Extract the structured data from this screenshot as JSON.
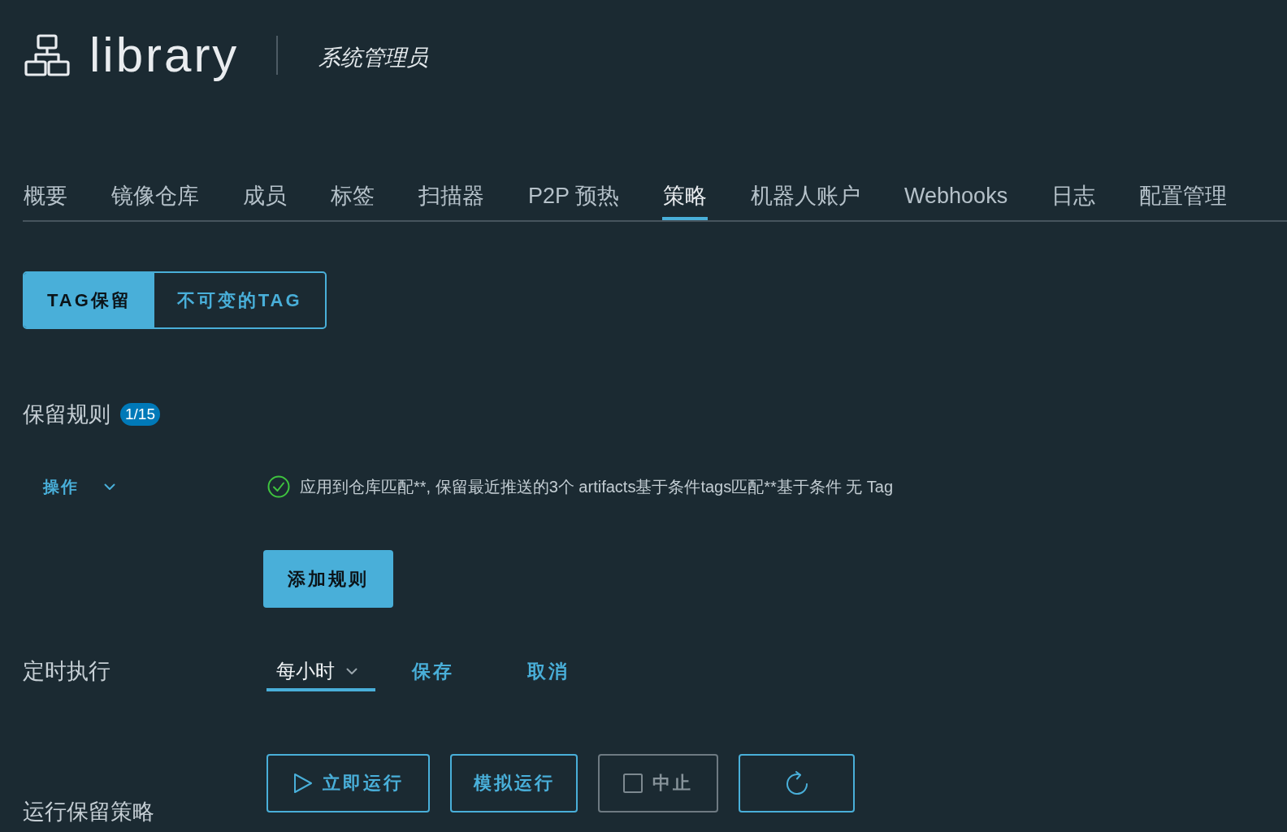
{
  "header": {
    "project_name": "library",
    "role": "系统管理员"
  },
  "tabs": [
    {
      "label": "概要",
      "selected": false
    },
    {
      "label": "镜像仓库",
      "selected": false
    },
    {
      "label": "成员",
      "selected": false
    },
    {
      "label": "标签",
      "selected": false
    },
    {
      "label": "扫描器",
      "selected": false
    },
    {
      "label": "P2P 预热",
      "selected": false
    },
    {
      "label": "策略",
      "selected": true
    },
    {
      "label": "机器人账户",
      "selected": false
    },
    {
      "label": "Webhooks",
      "selected": false
    },
    {
      "label": "日志",
      "selected": false
    },
    {
      "label": "配置管理",
      "selected": false
    }
  ],
  "policy_tabs": [
    {
      "label": "TAG保留",
      "selected": true
    },
    {
      "label": "不可变的TAG",
      "selected": false
    }
  ],
  "retention_rules": {
    "title": "保留规则",
    "count": "1/15",
    "action_menu": "操作",
    "rules": [
      {
        "enabled": true,
        "text": "应用到仓库匹配**, 保留最近推送的3个 artifacts基于条件tags匹配**基于条件 无 Tag"
      }
    ],
    "add_button": "添加规则"
  },
  "schedule": {
    "label": "定时执行",
    "value": "每小时",
    "save": "保存",
    "cancel": "取消"
  },
  "run": {
    "label": "运行保留策略",
    "buttons": [
      {
        "kind": "run",
        "label": "立即运行",
        "disabled": false
      },
      {
        "kind": "dry_run",
        "label": "模拟运行",
        "disabled": false
      },
      {
        "kind": "stop",
        "label": "中止",
        "disabled": true
      },
      {
        "kind": "refresh",
        "disabled": false
      }
    ]
  }
}
